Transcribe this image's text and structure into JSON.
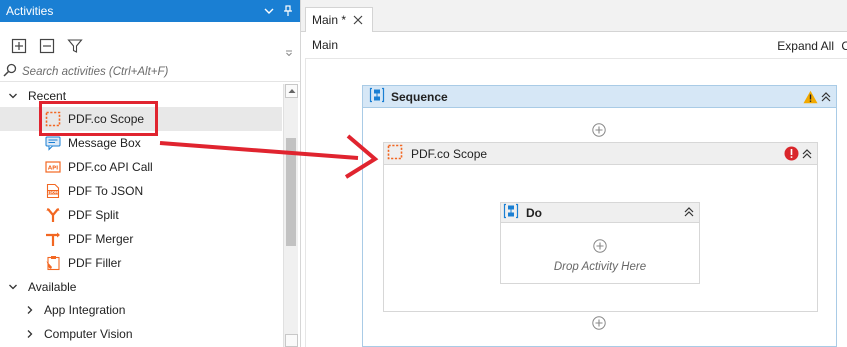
{
  "activities_panel": {
    "title": "Activities",
    "search_placeholder": "Search activities (Ctrl+Alt+F)",
    "sections": {
      "recent": "Recent",
      "available": "Available"
    },
    "recent_items": [
      {
        "label": "PDF.co Scope",
        "icon": "scope-icon"
      },
      {
        "label": "Message Box",
        "icon": "message-box-icon"
      },
      {
        "label": "PDF.co API Call",
        "icon": "api-call-icon"
      },
      {
        "label": "PDF To JSON",
        "icon": "json-icon"
      },
      {
        "label": "PDF Split",
        "icon": "split-icon"
      },
      {
        "label": "PDF Merger",
        "icon": "merge-icon"
      },
      {
        "label": "PDF Filler",
        "icon": "filler-icon"
      }
    ],
    "available_items": [
      {
        "label": "App Integration"
      },
      {
        "label": "Computer Vision"
      }
    ]
  },
  "designer": {
    "tab_label": "Main *",
    "breadcrumb": "Main",
    "expand_all": "Expand All",
    "expand_cut": "C",
    "sequence_title": "Sequence",
    "scope_title": "PDF.co Scope",
    "do_title": "Do",
    "drop_text": "Drop Activity Here"
  },
  "colors": {
    "accent": "#1a7fd3",
    "highlight": "#e0242f",
    "pdf_orange": "#f26722",
    "warning": "#f2a900",
    "error": "#d9262b"
  }
}
